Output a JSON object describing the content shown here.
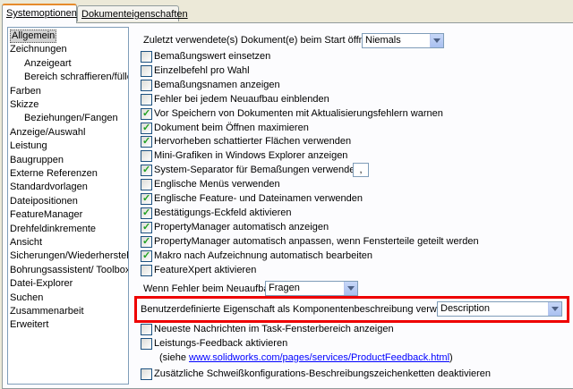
{
  "tabs": [
    "Systemoptionen",
    "Dokumenteigenschaften"
  ],
  "tree": [
    {
      "label": "Allgemein",
      "indent": 0,
      "selected": true
    },
    {
      "label": "Zeichnungen",
      "indent": 0
    },
    {
      "label": "Anzeigeart",
      "indent": 1
    },
    {
      "label": "Bereich schraffieren/füller",
      "indent": 1
    },
    {
      "label": "Farben",
      "indent": 0
    },
    {
      "label": "Skizze",
      "indent": 0
    },
    {
      "label": "Beziehungen/Fangen",
      "indent": 1
    },
    {
      "label": "Anzeige/Auswahl",
      "indent": 0
    },
    {
      "label": "Leistung",
      "indent": 0
    },
    {
      "label": "Baugruppen",
      "indent": 0
    },
    {
      "label": "Externe Referenzen",
      "indent": 0
    },
    {
      "label": "Standardvorlagen",
      "indent": 0
    },
    {
      "label": "Dateipositionen",
      "indent": 0
    },
    {
      "label": "FeatureManager",
      "indent": 0
    },
    {
      "label": "Drehfeldinkremente",
      "indent": 0
    },
    {
      "label": "Ansicht",
      "indent": 0
    },
    {
      "label": "Sicherungen/Wiederhersteller",
      "indent": 0
    },
    {
      "label": "Bohrungsassistent/ Toolbox",
      "indent": 0
    },
    {
      "label": "Datei-Explorer",
      "indent": 0
    },
    {
      "label": "Suchen",
      "indent": 0
    },
    {
      "label": "Zusammenarbeit",
      "indent": 0
    },
    {
      "label": "Erweitert",
      "indent": 0
    }
  ],
  "start_docs": {
    "label": "Zuletzt verwendete(s) Dokument(e) beim Start öffnen:",
    "value": "Niemals"
  },
  "options": [
    {
      "label": "Bemaßungswert einsetzen",
      "checked": false
    },
    {
      "label": "Einzelbefehl pro Wahl",
      "checked": false
    },
    {
      "label": "Bemaßungsnamen anzeigen",
      "checked": false
    },
    {
      "label": "Fehler bei jedem Neuaufbau einblenden",
      "checked": false
    },
    {
      "label": "Vor Speichern von Dokumenten mit Aktualisierungsfehlern warnen",
      "checked": true
    },
    {
      "label": "Dokument beim Öffnen maximieren",
      "checked": true
    },
    {
      "label": "Hervorheben schattierter Flächen verwenden",
      "checked": true
    },
    {
      "label": "Mini-Grafiken in Windows Explorer anzeigen",
      "checked": false
    },
    {
      "label": "System-Separator für Bemaßungen verwenden",
      "checked": true
    },
    {
      "label": "Englische Menüs verwenden",
      "checked": false
    },
    {
      "label": "Englische Feature- und Dateinamen verwenden",
      "checked": true
    },
    {
      "label": "Bestätigungs-Eckfeld aktivieren",
      "checked": true
    },
    {
      "label": "PropertyManager automatisch anzeigen",
      "checked": true
    },
    {
      "label": "PropertyManager automatisch anpassen, wenn Fensterteile geteilt werden",
      "checked": true
    },
    {
      "label": "Makro nach Aufzeichnung automatisch bearbeiten",
      "checked": true
    },
    {
      "label": "FeatureXpert aktivieren",
      "checked": false
    }
  ],
  "separator_value": ",",
  "rebuild_error": {
    "label": "Wenn Fehler beim Neuaufbau:",
    "value": "Fragen"
  },
  "custom_property": {
    "label": "Benutzerdefinierte Eigenschaft als Komponentenbeschreibung verwendet:",
    "value": "Description"
  },
  "news": {
    "label": "Neueste Nachrichten im Task-Fensterbereich anzeigen",
    "checked": false
  },
  "feedback": {
    "label": "Leistungs-Feedback aktivieren",
    "checked": false
  },
  "feedback_note": {
    "prefix": "(siehe ",
    "link": "www.solidworks.com/pages/services/ProductFeedback.html",
    "suffix": ")"
  },
  "weld": {
    "label": "Zusätzliche Schweißkonfigurations-Beschreibungszeichenketten deaktivieren",
    "checked": false
  },
  "accent_colors": {
    "tab_highlight": "#e68b2c",
    "red_highlight": "#e00000",
    "check": "#21a121"
  }
}
